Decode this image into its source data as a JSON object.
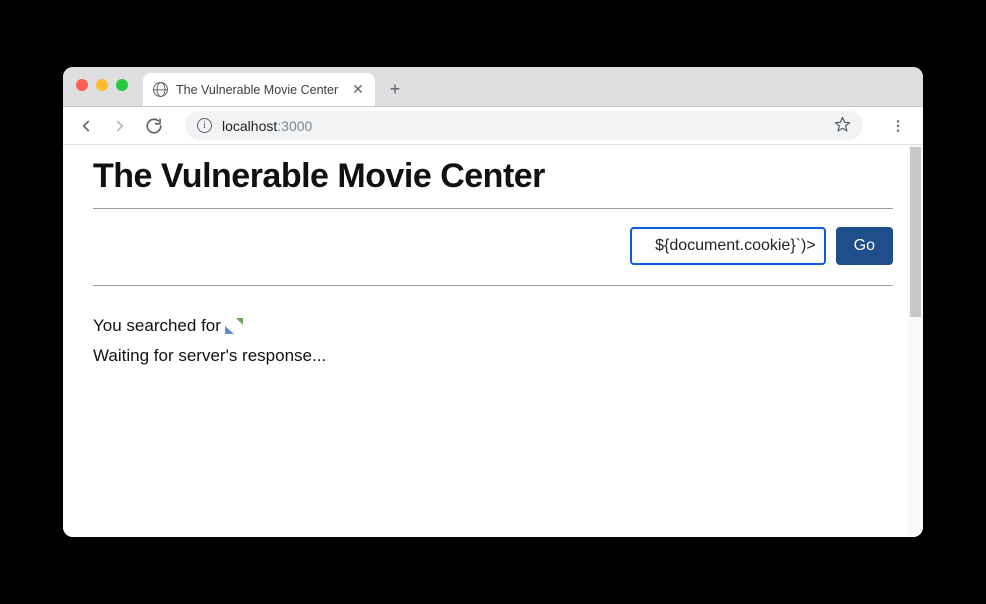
{
  "browser": {
    "tab_title": "The Vulnerable Movie Center",
    "url_host": "localhost",
    "url_port": ":3000"
  },
  "page": {
    "title": "The Vulnerable Movie Center",
    "search_value": "${document.cookie}`)>",
    "go_label": "Go",
    "result_prefix": "You searched for ",
    "waiting_text": "Waiting for server's response..."
  }
}
